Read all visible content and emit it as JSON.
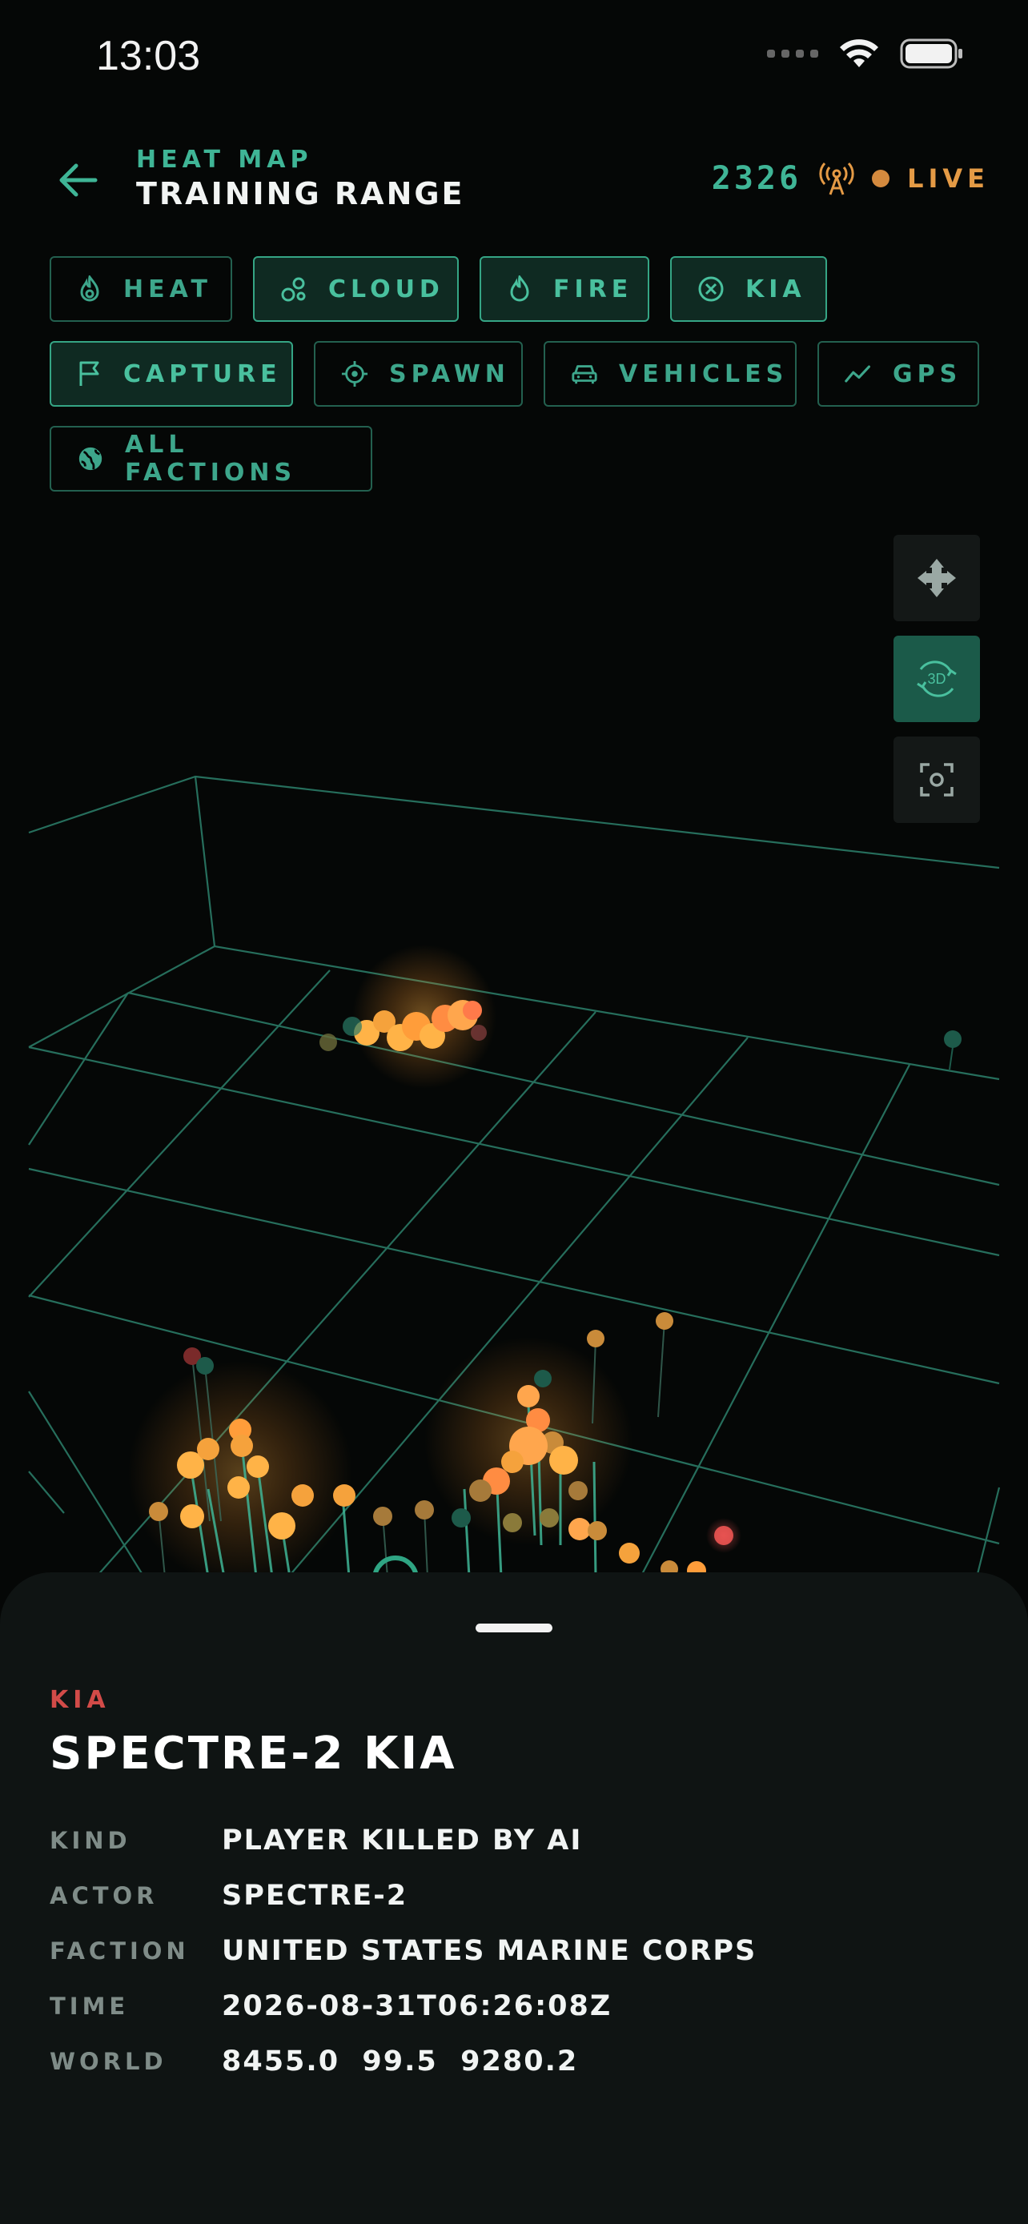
{
  "status_bar": {
    "time": "13:03"
  },
  "header": {
    "subtitle": "HEAT MAP",
    "title": "TRAINING RANGE",
    "event_count": "2326",
    "live_label": "LIVE"
  },
  "filters": {
    "row1": [
      {
        "label": "HEAT",
        "icon": "flame-outline-icon",
        "active": false
      },
      {
        "label": "CLOUD",
        "icon": "bubbles-icon",
        "active": true
      },
      {
        "label": "FIRE",
        "icon": "fire-icon",
        "active": true
      },
      {
        "label": "KIA",
        "icon": "x-circle-icon",
        "active": true
      }
    ],
    "row2": [
      {
        "label": "CAPTURE",
        "icon": "flag-icon",
        "active": true
      },
      {
        "label": "SPAWN",
        "icon": "crosshair-icon",
        "active": false
      },
      {
        "label": "VEHICLES",
        "icon": "car-icon",
        "active": false
      },
      {
        "label": "GPS",
        "icon": "trend-line-icon",
        "active": false
      }
    ],
    "row3": [
      {
        "label": "ALL FACTIONS",
        "icon": "globe-icon",
        "active": false
      }
    ]
  },
  "map_controls": [
    {
      "icon": "move-arrows-icon",
      "active": false
    },
    {
      "icon": "rotate-3d-icon",
      "label": "3D",
      "active": true
    },
    {
      "icon": "focus-icon",
      "active": false
    }
  ],
  "colors": {
    "accent": "#3fb596",
    "live": "#e49a45",
    "kia": "#d24b48",
    "heat": "#ffb347",
    "grid": "#2a7a66"
  },
  "detail_sheet": {
    "tag": "KIA",
    "title": "SPECTRE-2 KIA",
    "rows": [
      {
        "key": "KIND",
        "value": "PLAYER KILLED BY AI"
      },
      {
        "key": "ACTOR",
        "value": "SPECTRE-2"
      },
      {
        "key": "FACTION",
        "value": "UNITED STATES MARINE CORPS"
      },
      {
        "key": "TIME",
        "value": "2026-08-31T06:26:08Z"
      },
      {
        "key": "WORLD",
        "value": "8455.0  99.5  9280.2"
      }
    ]
  }
}
